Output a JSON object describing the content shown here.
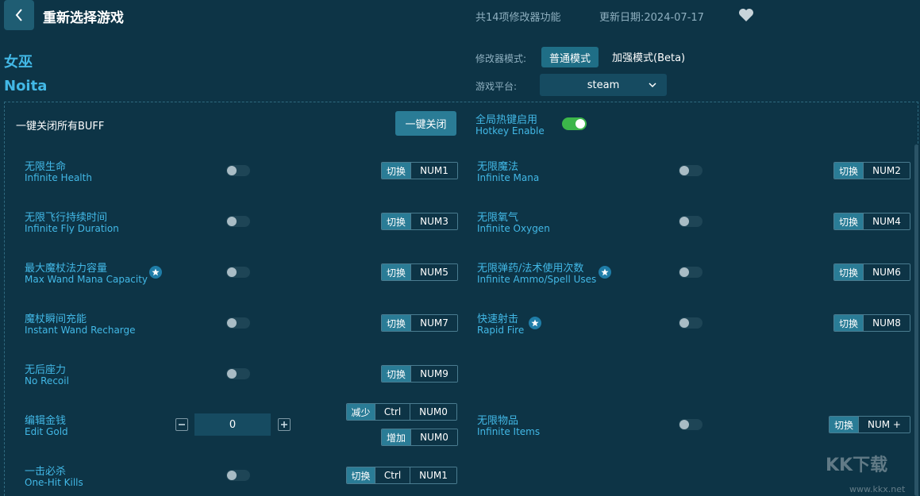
{
  "header": {
    "title": "重新选择游戏",
    "feature_count": "共14项修改器功能",
    "update_date": "更新日期:2024-07-17"
  },
  "game": {
    "name_cn": "女巫",
    "name_en": "Noita"
  },
  "modes": {
    "label": "修改器模式:",
    "normal": "普通模式",
    "enhanced": "加强模式(Beta)"
  },
  "platform": {
    "label": "游戏平台:",
    "value": "steam"
  },
  "global": {
    "close_all_label": "一键关闭所有BUFF",
    "close_all_button": "一键关闭",
    "hotkey_cn": "全局热键启用",
    "hotkey_en": "Hotkey Enable",
    "hotkey_enabled": true
  },
  "actions": {
    "toggle": "切换",
    "decrease": "减少",
    "increase": "增加"
  },
  "cheats": [
    {
      "cn": "无限生命",
      "en": "Infinite Health",
      "key": "NUM1"
    },
    {
      "cn": "无限魔法",
      "en": "Infinite Mana",
      "key": "NUM2"
    },
    {
      "cn": "无限飞行持续时间",
      "en": "Infinite Fly Duration",
      "key": "NUM3"
    },
    {
      "cn": "无限氧气",
      "en": "Infinite Oxygen",
      "key": "NUM4"
    },
    {
      "cn": "最大魔杖法力容量",
      "en": "Max Wand Mana Capacity",
      "key": "NUM5"
    },
    {
      "cn": "无限弹药/法术使用次数",
      "en": "Infinite Ammo/Spell Uses",
      "key": "NUM6"
    },
    {
      "cn": "魔杖瞬间充能",
      "en": "Instant Wand Recharge",
      "key": "NUM7"
    },
    {
      "cn": "快速射击",
      "en": "Rapid Fire",
      "key": "NUM8"
    },
    {
      "cn": "无后座力",
      "en": "No Recoil",
      "key": "NUM9"
    },
    {
      "cn": "编辑金钱",
      "en": "Edit Gold",
      "value": "0",
      "dec_mod": "Ctrl",
      "dec_key": "NUM0",
      "inc_key": "NUM0"
    },
    {
      "cn": "无限物品",
      "en": "Infinite Items",
      "key": "NUM +"
    },
    {
      "cn": "一击必杀",
      "en": "One-Hit Kills",
      "mod": "Ctrl",
      "key": "NUM1"
    }
  ],
  "watermark": {
    "text": "KK下载",
    "url": "www.kkx.net"
  },
  "colors": {
    "background": "#0d3446",
    "accent": "#42b8e6",
    "button": "#2a7c96",
    "switch_on": "#3cb64a"
  }
}
